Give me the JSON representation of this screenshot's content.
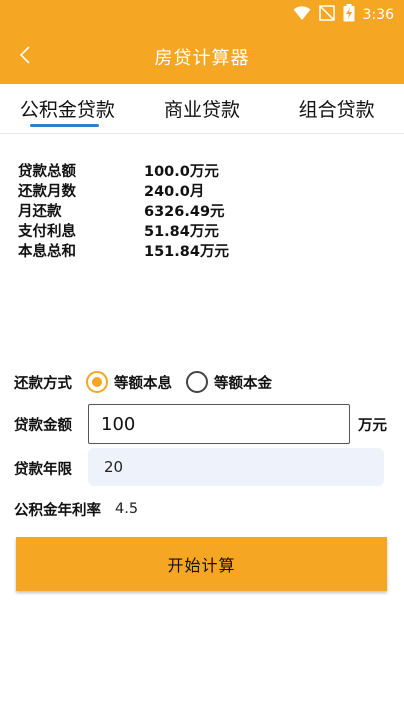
{
  "status_bar": {
    "time": "3:36",
    "icons": [
      "wifi-icon",
      "no-signal-icon",
      "battery-charging-icon"
    ]
  },
  "app_bar": {
    "title": "房贷计算器",
    "back_icon": "chevron-left-icon"
  },
  "tabs": [
    {
      "label": "公积金贷款",
      "active": true
    },
    {
      "label": "商业贷款",
      "active": false
    },
    {
      "label": "组合贷款",
      "active": false
    }
  ],
  "results": [
    {
      "label": "贷款总额",
      "value": "100.0万元"
    },
    {
      "label": "还款月数",
      "value": "240.0月"
    },
    {
      "label": "月还款",
      "value": "6326.49元"
    },
    {
      "label": "支付利息",
      "value": "51.84万元"
    },
    {
      "label": "本息总和",
      "value": "151.84万元"
    }
  ],
  "form": {
    "repay_method_label": "还款方式",
    "repay_options": [
      {
        "label": "等额本息",
        "checked": true
      },
      {
        "label": "等额本金",
        "checked": false
      }
    ],
    "amount_label": "贷款金额",
    "amount_value": "100",
    "amount_unit": "万元",
    "years_label": "贷款年限",
    "years_value": "20",
    "rate_label": "公积金年利率",
    "rate_value": "4.5"
  },
  "calc_button": {
    "label": "开始计算"
  },
  "colors": {
    "accent": "#f5a623",
    "tab_indicator": "#2f7fd0",
    "input_bg": "#eef3fb"
  }
}
